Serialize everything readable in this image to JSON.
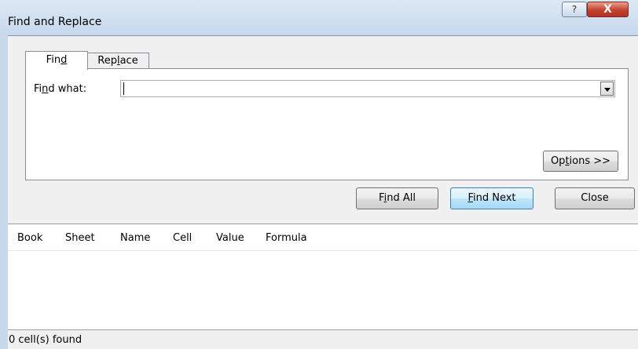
{
  "window": {
    "title": "Find and Replace",
    "help_glyph": "?",
    "close_glyph": "X"
  },
  "tabs": {
    "find_pre": "Fin",
    "find_u": "d",
    "find_post": "",
    "replace_pre": "Rep",
    "replace_u": "l",
    "replace_post": "ace",
    "active": "Find"
  },
  "find": {
    "label_pre": "Fi",
    "label_u": "n",
    "label_post": "d what:",
    "value": ""
  },
  "buttons": {
    "options_pre": "Op",
    "options_u": "t",
    "options_post": "ions >>",
    "findall_pre": "F",
    "findall_u": "i",
    "findall_post": "nd All",
    "findnext_pre": "",
    "findnext_u": "F",
    "findnext_post": "ind Next",
    "close": "Close"
  },
  "results": {
    "columns": [
      "Book",
      "Sheet",
      "Name",
      "Cell",
      "Value",
      "Formula"
    ],
    "rows": []
  },
  "status": "0 cell(s) found",
  "colors": {
    "titlebar": "#c6d8ec",
    "close_button": "#c4412e",
    "dialog_bg": "#f0f0f0",
    "default_button_border": "#3c7fb1"
  }
}
